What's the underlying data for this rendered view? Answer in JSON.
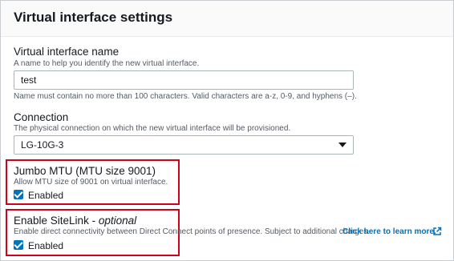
{
  "panel": {
    "title": "Virtual interface settings"
  },
  "vif_name": {
    "label": "Virtual interface name",
    "description": "A name to help you identify the new virtual interface.",
    "value": "test",
    "constraint": "Name must contain no more than 100 characters. Valid characters are a-z, 0-9, and hyphens (–)."
  },
  "connection": {
    "label": "Connection",
    "description": "The physical connection on which the new virtual interface will be provisioned.",
    "selected": "LG-10G-3"
  },
  "jumbo": {
    "label": "Jumbo MTU (MTU size 9001)",
    "description": "Allow MTU size of 9001 on virtual interface.",
    "checkbox_label": "Enabled",
    "checked": true
  },
  "sitelink": {
    "label": "Enable SiteLink - ",
    "optional": "optional",
    "description": "Enable direct connectivity between Direct Connect points of presence. Subject to additional charges.",
    "link_text": "Click here to learn more.",
    "link_icon": "external-link-icon",
    "checkbox_label": "Enabled",
    "checked": true
  },
  "colors": {
    "accent": "#0073bb",
    "highlight": "#d0021b"
  }
}
